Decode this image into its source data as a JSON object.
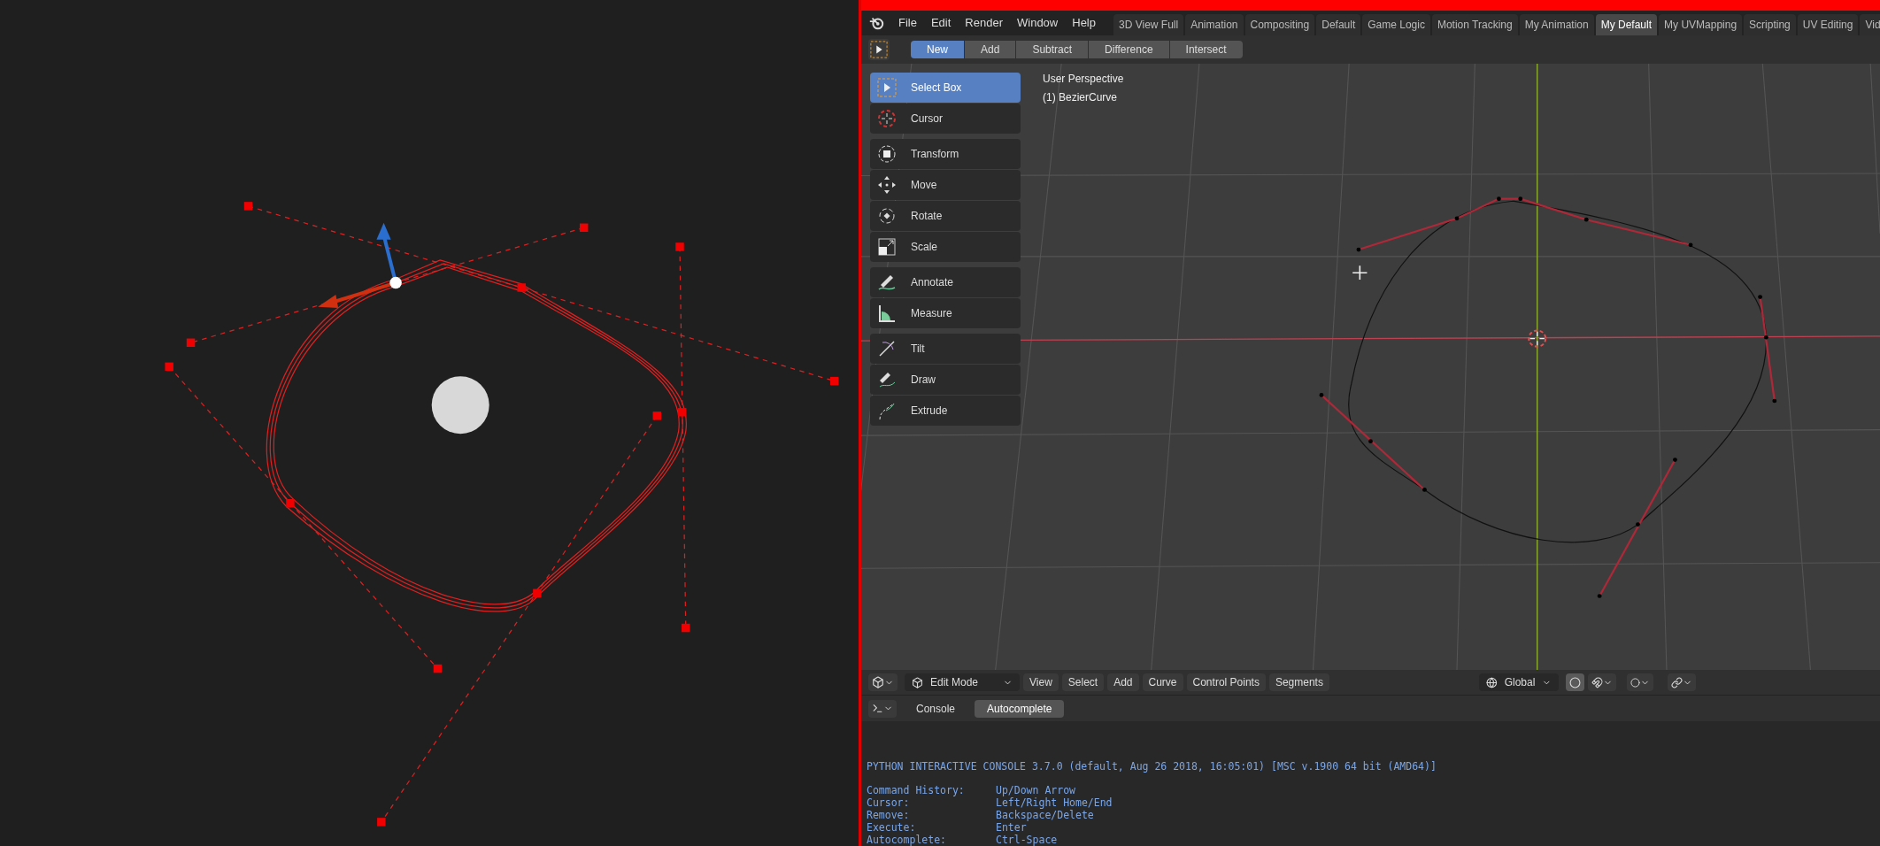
{
  "menu": [
    "File",
    "Edit",
    "Render",
    "Window",
    "Help"
  ],
  "workspaces": [
    {
      "label": "3D View Full",
      "selected": false
    },
    {
      "label": "Animation",
      "selected": false
    },
    {
      "label": "Compositing",
      "selected": false
    },
    {
      "label": "Default",
      "selected": false
    },
    {
      "label": "Game Logic",
      "selected": false
    },
    {
      "label": "Motion Tracking",
      "selected": false
    },
    {
      "label": "My Animation",
      "selected": false
    },
    {
      "label": "My Default",
      "selected": true
    },
    {
      "label": "My UVMapping",
      "selected": false
    },
    {
      "label": "Scripting",
      "selected": false
    },
    {
      "label": "UV Editing",
      "selected": false
    },
    {
      "label": "Vid",
      "selected": false
    }
  ],
  "selection_modes": [
    {
      "label": "New",
      "selected": true
    },
    {
      "label": "Add",
      "selected": false
    },
    {
      "label": "Subtract",
      "selected": false
    },
    {
      "label": "Difference",
      "selected": false
    },
    {
      "label": "Intersect",
      "selected": false
    }
  ],
  "viewport": {
    "view_name": "User Perspective",
    "object_label": "(1) BezierCurve"
  },
  "tool_groups": [
    {
      "tools": [
        {
          "kind": "select",
          "label": "Select Box",
          "selected": true
        },
        {
          "kind": "cursor",
          "label": "Cursor",
          "selected": false
        }
      ]
    },
    {
      "tools": [
        {
          "kind": "transform",
          "label": "Transform",
          "selected": false
        },
        {
          "kind": "move",
          "label": "Move",
          "selected": false
        },
        {
          "kind": "rotate",
          "label": "Rotate",
          "selected": false
        },
        {
          "kind": "scale",
          "label": "Scale",
          "selected": false
        }
      ]
    },
    {
      "tools": [
        {
          "kind": "annotate",
          "label": "Annotate",
          "selected": false
        },
        {
          "kind": "measure",
          "label": "Measure",
          "selected": false
        }
      ]
    },
    {
      "tools": [
        {
          "kind": "tilt",
          "label": "Tilt",
          "selected": false
        },
        {
          "kind": "draw",
          "label": "Draw",
          "selected": false
        },
        {
          "kind": "extrude",
          "label": "Extrude",
          "selected": false
        }
      ]
    }
  ],
  "viewport_header": {
    "mode": "Edit Mode",
    "menus": [
      "View",
      "Select",
      "Add",
      "Curve",
      "Control Points",
      "Segments"
    ],
    "orientation": "Global"
  },
  "console": {
    "tabs": [
      {
        "label": "Console",
        "selected": false
      },
      {
        "label": "Autocomplete",
        "selected": true
      }
    ],
    "banner": "PYTHON INTERACTIVE CONSOLE 3.7.0 (default, Aug 26 2018, 16:05:01) [MSC v.1900 64 bit (AMD64)]",
    "help": [
      {
        "key": "Command History:",
        "value": "Up/Down Arrow"
      },
      {
        "key": "Cursor:",
        "value": "Left/Right Home/End"
      },
      {
        "key": "Remove:",
        "value": "Backspace/Delete"
      },
      {
        "key": "Execute:",
        "value": "Enter"
      },
      {
        "key": "Autocomplete:",
        "value": "Ctrl-Space"
      }
    ]
  }
}
